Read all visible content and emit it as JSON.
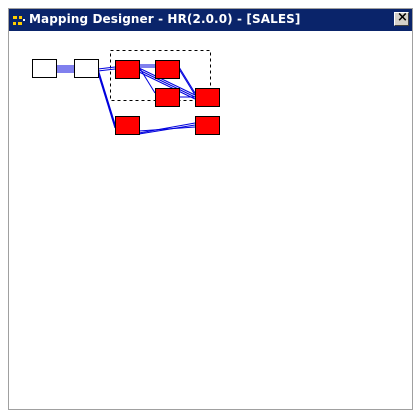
{
  "window": {
    "title": "Mapping Designer - HR(2.0.0) - [SALES]",
    "close_glyph": "×",
    "app_icon": "grid-app-icon",
    "close_icon": "close-icon"
  },
  "diagram": {
    "node_fill_selected": "#ff0000",
    "node_fill_plain": "#ffffff",
    "link_color": "#0000dd",
    "selection_border_color": "#000000"
  }
}
